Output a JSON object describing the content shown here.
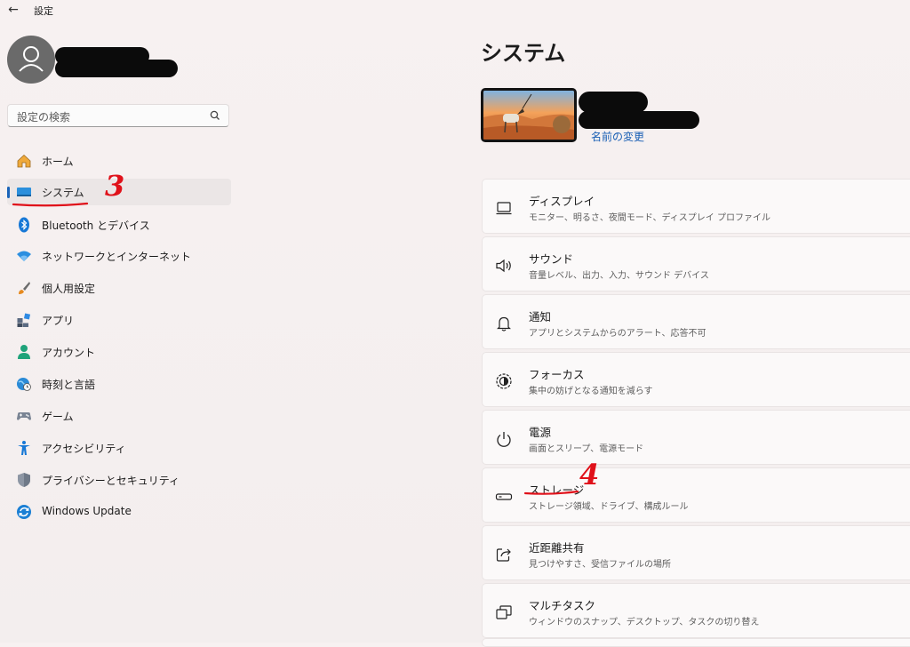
{
  "window": {
    "title": "設定"
  },
  "sidebar": {
    "search_placeholder": "設定の検索",
    "items": [
      {
        "label": "ホーム",
        "icon": "home-icon"
      },
      {
        "label": "システム",
        "icon": "system-icon",
        "selected": true
      },
      {
        "label": "Bluetooth とデバイス",
        "icon": "bluetooth-icon"
      },
      {
        "label": "ネットワークとインターネット",
        "icon": "wifi-icon"
      },
      {
        "label": "個人用設定",
        "icon": "brush-icon"
      },
      {
        "label": "アプリ",
        "icon": "apps-icon"
      },
      {
        "label": "アカウント",
        "icon": "account-icon"
      },
      {
        "label": "時刻と言語",
        "icon": "globe-clock-icon"
      },
      {
        "label": "ゲーム",
        "icon": "gamepad-icon"
      },
      {
        "label": "アクセシビリティ",
        "icon": "accessibility-icon"
      },
      {
        "label": "プライバシーとセキュリティ",
        "icon": "shield-icon"
      },
      {
        "label": "Windows Update",
        "icon": "update-icon"
      }
    ]
  },
  "main": {
    "title": "システム",
    "rename_link": "名前の変更",
    "cards": [
      {
        "title": "ディスプレイ",
        "subtitle": "モニター、明るさ、夜間モード、ディスプレイ プロファイル",
        "icon": "monitor-icon"
      },
      {
        "title": "サウンド",
        "subtitle": "音量レベル、出力、入力、サウンド デバイス",
        "icon": "speaker-icon"
      },
      {
        "title": "通知",
        "subtitle": "アプリとシステムからのアラート、応答不可",
        "icon": "bell-icon"
      },
      {
        "title": "フォーカス",
        "subtitle": "集中の妨げとなる通知を減らす",
        "icon": "focus-icon"
      },
      {
        "title": "電源",
        "subtitle": "画面とスリープ、電源モード",
        "icon": "power-icon"
      },
      {
        "title": "ストレージ",
        "subtitle": "ストレージ領域、ドライブ、構成ルール",
        "icon": "storage-icon"
      },
      {
        "title": "近距離共有",
        "subtitle": "見つけやすさ、受信ファイルの場所",
        "icon": "share-icon"
      },
      {
        "title": "マルチタスク",
        "subtitle": "ウィンドウのスナップ、デスクトップ、タスクの切り替え",
        "icon": "multitask-icon"
      }
    ]
  },
  "annotations": {
    "step3": "3",
    "step4": "4"
  },
  "colors": {
    "accent": "#1a63b8",
    "annotation": "#e0111a"
  }
}
